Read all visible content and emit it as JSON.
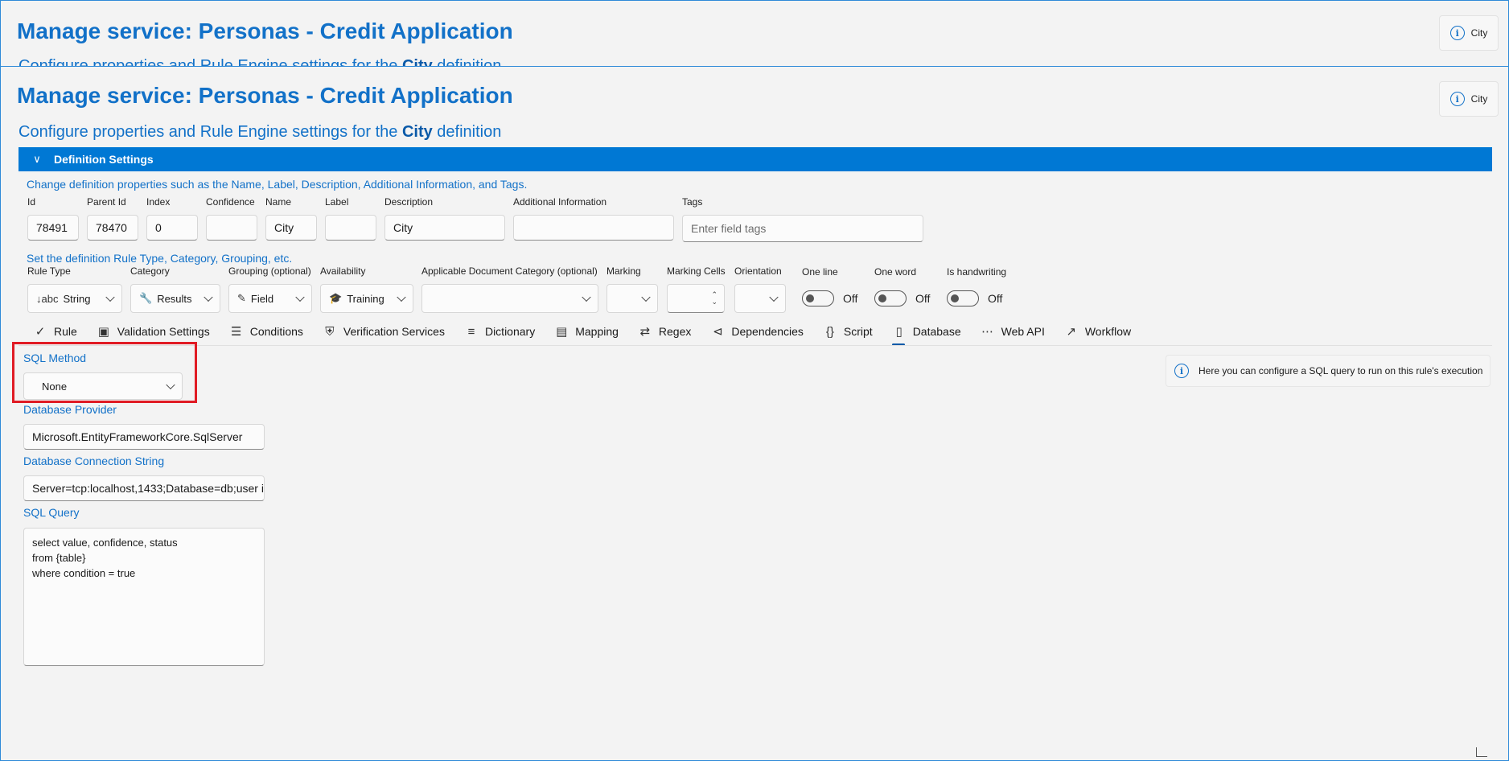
{
  "back_window": {
    "title": "Manage service: Personas - Credit Application",
    "subtitle_prefix": "Configure properties and Rule Engine settings for the ",
    "subtitle_entity": "City",
    "subtitle_suffix": " definition",
    "info_chip": "City"
  },
  "front_window": {
    "title": "Manage service: Personas - Credit Application",
    "subtitle_prefix": "Configure properties and Rule Engine settings for the ",
    "subtitle_entity": "City",
    "subtitle_suffix": " definition",
    "info_chip": "City"
  },
  "section": {
    "label": "Definition Settings"
  },
  "properties": {
    "hint": "Change definition properties such as the Name, Label, Description, Additional Information, and Tags.",
    "fields": {
      "id": {
        "label": "Id",
        "value": "78491"
      },
      "parent_id": {
        "label": "Parent Id",
        "value": "78470"
      },
      "index": {
        "label": "Index",
        "value": "0"
      },
      "confidence": {
        "label": "Confidence",
        "value": ""
      },
      "name": {
        "label": "Name",
        "value": "City"
      },
      "label": {
        "label": "Label",
        "value": ""
      },
      "description": {
        "label": "Description",
        "value": "City"
      },
      "additional_information": {
        "label": "Additional Information",
        "value": ""
      },
      "tags": {
        "label": "Tags",
        "placeholder": "Enter field tags"
      }
    }
  },
  "rule_settings": {
    "hint": "Set the definition Rule Type, Category, Grouping, etc.",
    "rule_type": {
      "label": "Rule Type",
      "value": "String",
      "icon": "sort-abc-icon"
    },
    "category": {
      "label": "Category",
      "value": "Results",
      "icon": "wrench-icon"
    },
    "grouping": {
      "label": "Grouping (optional)",
      "value": "Field",
      "icon": "pen-icon"
    },
    "availability": {
      "label": "Availability",
      "value": "Training",
      "icon": "graduation-cap-icon"
    },
    "applicable_category": {
      "label": "Applicable Document Category (optional)",
      "value": ""
    },
    "marking": {
      "label": "Marking",
      "value": ""
    },
    "marking_cells": {
      "label": "Marking Cells",
      "value": ""
    },
    "orientation": {
      "label": "Orientation",
      "value": ""
    },
    "one_line": {
      "label": "One line",
      "state": "Off"
    },
    "one_word": {
      "label": "One word",
      "state": "Off"
    },
    "is_handwriting": {
      "label": "Is handwriting",
      "state": "Off"
    }
  },
  "tabs": [
    {
      "label": "Rule",
      "icon": "check-icon"
    },
    {
      "label": "Validation Settings",
      "icon": "scan-icon"
    },
    {
      "label": "Conditions",
      "icon": "list-icon"
    },
    {
      "label": "Verification Services",
      "icon": "shield-icon"
    },
    {
      "label": "Dictionary",
      "icon": "dictionary-icon"
    },
    {
      "label": "Mapping",
      "icon": "book-icon"
    },
    {
      "label": "Regex",
      "icon": "regex-icon"
    },
    {
      "label": "Dependencies",
      "icon": "share-icon"
    },
    {
      "label": "Script",
      "icon": "braces-icon"
    },
    {
      "label": "Database",
      "icon": "phone-icon",
      "active": true
    },
    {
      "label": "Web API",
      "icon": "globe-dots-icon"
    },
    {
      "label": "Workflow",
      "icon": "workflow-icon"
    }
  ],
  "database": {
    "sql_method": {
      "label": "SQL Method",
      "value": "None"
    },
    "provider": {
      "label": "Database Provider",
      "value": "Microsoft.EntityFrameworkCore.SqlServer"
    },
    "connection_string": {
      "label": "Database Connection String",
      "value": "Server=tcp:localhost,1433;Database=db;user i"
    },
    "sql_query": {
      "label": "SQL Query",
      "lines": [
        "select value, confidence, status",
        "from {table}",
        "where condition = true"
      ]
    },
    "info": "Here you can configure a SQL query to run on this rule's execution"
  },
  "colors": {
    "accent": "#0078d4",
    "title": "#1271c8",
    "highlight": "#e01b24"
  }
}
